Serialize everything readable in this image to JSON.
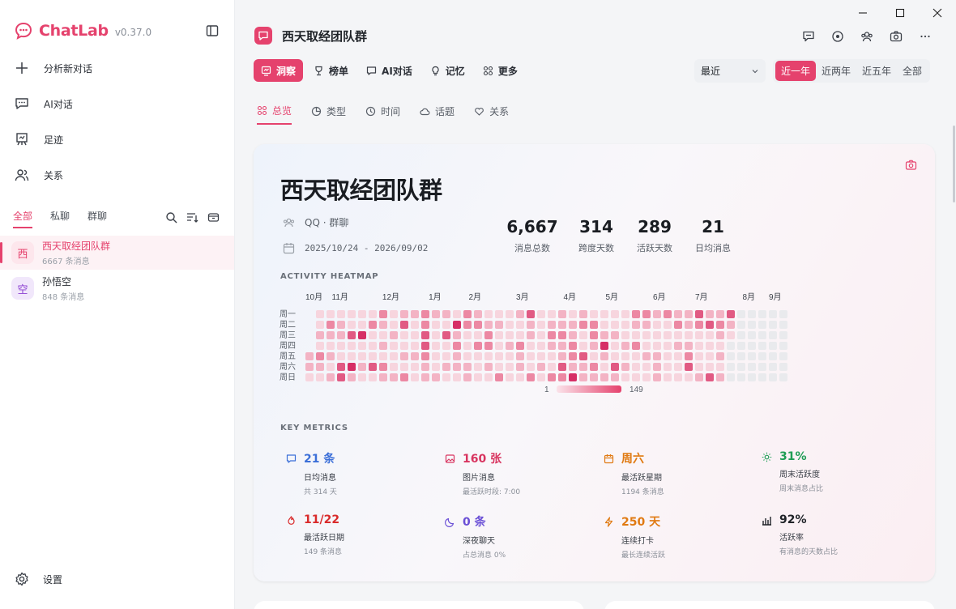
{
  "app": {
    "name": "ChatLab",
    "version": "v0.37.0"
  },
  "sidebar": {
    "nav": [
      {
        "label": "分析新对话",
        "icon": "plus-icon"
      },
      {
        "label": "AI对话",
        "icon": "chat-bubble-icon"
      },
      {
        "label": "足迹",
        "icon": "footprint-icon"
      },
      {
        "label": "关系",
        "icon": "users-icon"
      }
    ],
    "filters": [
      "全部",
      "私聊",
      "群聊"
    ],
    "chats": [
      {
        "avatar": "西",
        "name": "西天取经团队群",
        "count": "6667 条消息",
        "color": "#e5426d",
        "bg": "#fde6ec"
      },
      {
        "avatar": "空",
        "name": "孙悟空",
        "count": "848 条消息",
        "color": "#8b3fd1",
        "bg": "#f1e7fb"
      }
    ],
    "settings": "设置"
  },
  "header": {
    "group_title": "西天取经团队群",
    "tabs": [
      {
        "label": "洞察",
        "icon": "insight-icon"
      },
      {
        "label": "榜单",
        "icon": "trophy-icon"
      },
      {
        "label": "AI对话",
        "icon": "chat-bubble-icon"
      },
      {
        "label": "记忆",
        "icon": "bulb-icon"
      },
      {
        "label": "更多",
        "icon": "grid-icon"
      }
    ],
    "select_value": "最近",
    "ranges": [
      "近一年",
      "近两年",
      "近五年",
      "全部"
    ]
  },
  "subtabs": [
    {
      "label": "总览",
      "icon": "grid-icon"
    },
    {
      "label": "类型",
      "icon": "pie-icon"
    },
    {
      "label": "时间",
      "icon": "clock-icon"
    },
    {
      "label": "话题",
      "icon": "cloud-icon"
    },
    {
      "label": "关系",
      "icon": "heart-icon"
    }
  ],
  "overview": {
    "title": "西天取经团队群",
    "platform": "QQ · 群聊",
    "date_range": "2025/10/24 - 2026/09/02",
    "stats": [
      {
        "value": "6,667",
        "label": "消息总数"
      },
      {
        "value": "314",
        "label": "跨度天数"
      },
      {
        "value": "289",
        "label": "活跃天数"
      },
      {
        "value": "21",
        "label": "日均消息"
      }
    ],
    "heatmap_label": "ACTIVITY HEATMAP",
    "months": [
      "10月",
      "11月",
      "12月",
      "1月",
      "2月",
      "3月",
      "4月",
      "5月",
      "6月",
      "7月",
      "8月",
      "9月"
    ],
    "weekdays": [
      "周一",
      "周二",
      "周三",
      "周四",
      "周五",
      "周六",
      "周日"
    ],
    "legend_min": "1",
    "legend_max": "149",
    "metrics_label": "KEY METRICS",
    "metrics": [
      {
        "value": "21 条",
        "label": "日均消息",
        "sub": "共 314 天",
        "color": "#3b6fd8",
        "icon": "chat-icon"
      },
      {
        "value": "160 张",
        "label": "图片消息",
        "sub": "最活跃时段: 7:00",
        "color": "#d8345f",
        "icon": "image-icon"
      },
      {
        "value": "周六",
        "label": "最活跃星期",
        "sub": "1194 条消息",
        "color": "#e07a12",
        "icon": "calendar-icon"
      },
      {
        "value": "31%",
        "label": "周末活跃度",
        "sub": "周末消息占比",
        "color": "#1f9d55",
        "icon": "sun-icon"
      },
      {
        "value": "11/22",
        "label": "最活跃日期",
        "sub": "149 条消息",
        "color": "#d92b2b",
        "icon": "fire-icon"
      },
      {
        "value": "0 条",
        "label": "深夜聊天",
        "sub": "占总消息 0%",
        "color": "#6a4fd6",
        "icon": "moon-icon"
      },
      {
        "value": "250 天",
        "label": "连续打卡",
        "sub": "最长连续活跃",
        "color": "#e07a12",
        "icon": "bolt-icon"
      },
      {
        "value": "92%",
        "label": "活跃率",
        "sub": "有消息的天数占比",
        "color": "#1f2328",
        "icon": "bar-chart-icon"
      }
    ]
  }
}
